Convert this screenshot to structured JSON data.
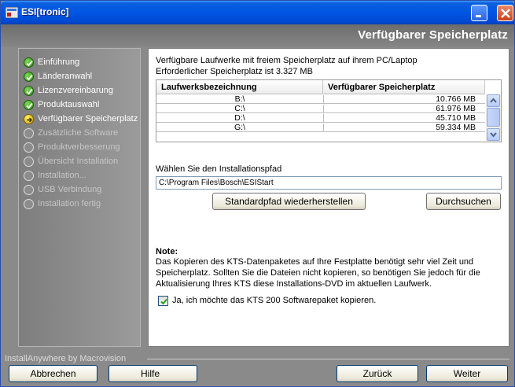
{
  "window": {
    "title": "ESI[tronic]",
    "header_title": "Verfügbarer Speicherplatz"
  },
  "steps": [
    {
      "label": "Einführung",
      "state": "done"
    },
    {
      "label": "Länderanwahl",
      "state": "done"
    },
    {
      "label": "Lizenzvereinbarung",
      "state": "done"
    },
    {
      "label": "Produktauswahl",
      "state": "done"
    },
    {
      "label": "Verfügbarer Speicherplatz",
      "state": "current"
    },
    {
      "label": "Zusätzliche Software",
      "state": "pending"
    },
    {
      "label": "Produktverbesserung",
      "state": "pending"
    },
    {
      "label": "Übersicht Installation",
      "state": "pending"
    },
    {
      "label": "Installation...",
      "state": "pending"
    },
    {
      "label": "USB Verbindung",
      "state": "pending"
    },
    {
      "label": "Installation fertig",
      "state": "pending"
    }
  ],
  "content": {
    "intro_line1": "Verfügbare Laufwerke mit freiem Speicherplatz auf ihrem PC/Laptop",
    "intro_line2": "Erforderlicher Speicherplatz ist 3.327 MB",
    "table": {
      "col_drive": "Laufwerksbezeichnung",
      "col_space": "Verfügbarer Speicherplatz",
      "rows": [
        {
          "drive": "B:\\",
          "space": "10.766  MB"
        },
        {
          "drive": "C:\\",
          "space": "61.976  MB"
        },
        {
          "drive": "D:\\",
          "space": "45.710  MB"
        },
        {
          "drive": "G:\\",
          "space": "59.334  MB"
        }
      ]
    },
    "path_label": "Wählen Sie den Installationspfad",
    "path_value": "C:\\Program Files\\Bosch\\ESIStart",
    "restore_button": "Standardpfad wiederherstellen",
    "browse_button": "Durchsuchen",
    "note_title": "Note:",
    "note_line1": "Das Kopieren des KTS-Datenpaketes auf Ihre Festplatte benötigt sehr viel Zeit und",
    "note_line2": "Speicherplatz. Sollten Sie die Dateien nicht kopieren, so benötigen Sie jedoch für die",
    "note_line3": "Aktualisierung Ihres KTS diese Installations-DVD im aktuellen Laufwerk.",
    "checkbox_label": "Ja, ich möchte das KTS 200 Softwarepaket kopieren.",
    "checkbox_checked": true
  },
  "footer": {
    "brand": "InstallAnywhere by Macrovision",
    "cancel_button": "Abbrechen",
    "help_button": "Hilfe",
    "back_button": "Zurück",
    "next_button": "Weiter"
  }
}
